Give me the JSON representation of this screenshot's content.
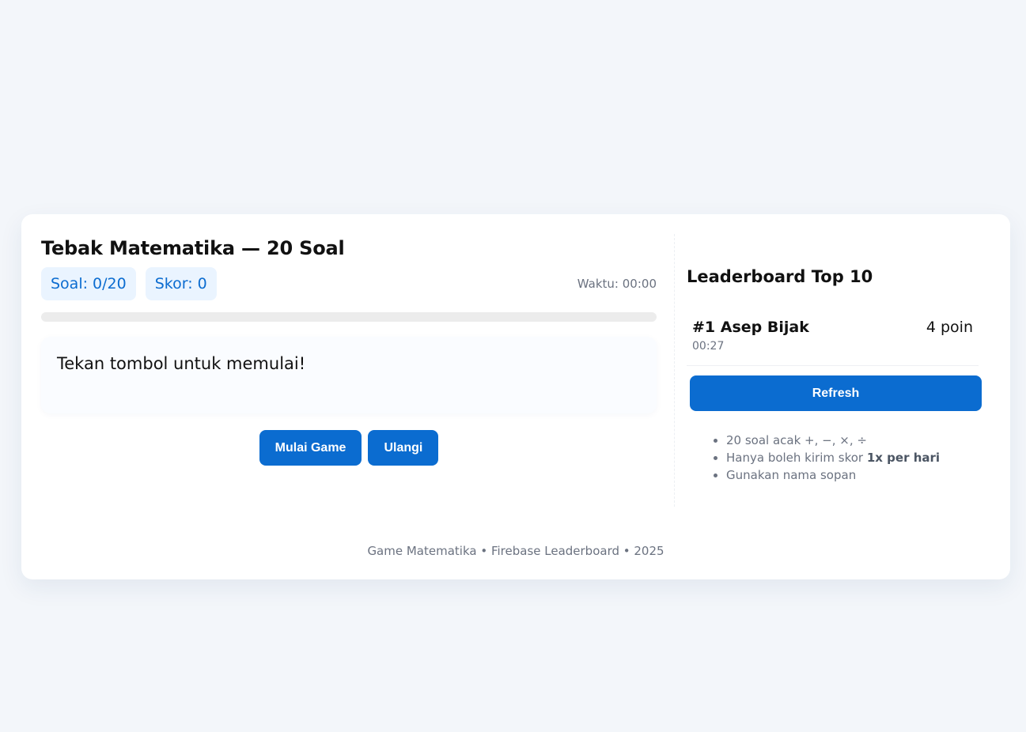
{
  "game": {
    "title": "Tebak Matematika — 20 Soal",
    "question_counter": "Soal: 0/20",
    "score": "Skor: 0",
    "timer": "Waktu: 00:00",
    "progress_percent": 0,
    "prompt": "Tekan tombol untuk memulai!",
    "start_label": "Mulai Game",
    "restart_label": "Ulangi"
  },
  "leaderboard": {
    "title": "Leaderboard Top 10",
    "entries": [
      {
        "rank_name": "#1 Asep Bijak",
        "points": "4 poin",
        "time": "00:27"
      }
    ],
    "refresh_label": "Refresh"
  },
  "rules": {
    "item1": "20 soal acak +, −, ×, ÷",
    "item2_prefix": "Hanya boleh kirim skor ",
    "item2_bold": "1x per hari",
    "item3": "Gunakan nama sopan"
  },
  "footer": {
    "text": "Game Matematika • Firebase Leaderboard • 2025"
  },
  "colors": {
    "accent": "#0b6cd0",
    "pill_bg": "#eaf4ff",
    "page_bg": "#f3f6fa"
  }
}
